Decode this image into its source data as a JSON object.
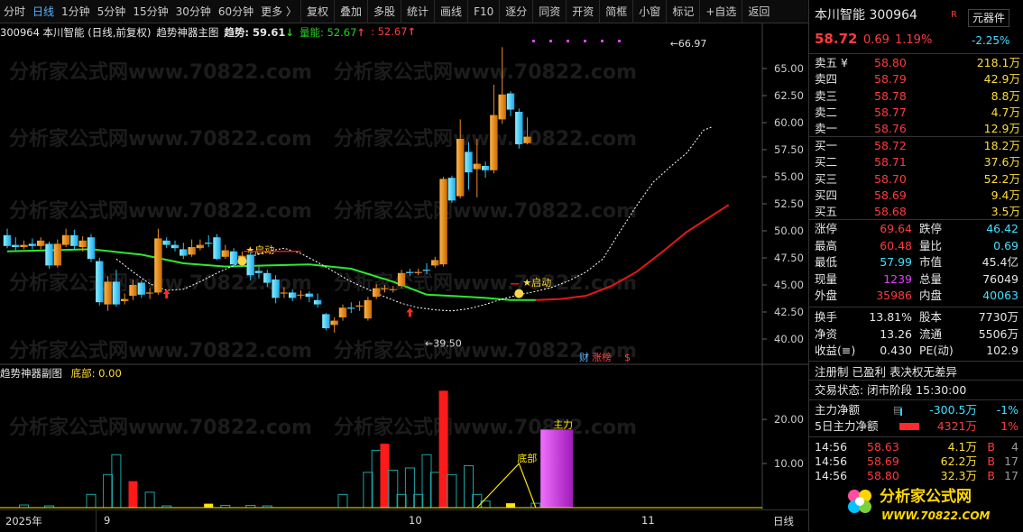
{
  "toolbar": {
    "items": [
      "分时",
      "日线",
      "1分钟",
      "5分钟",
      "15分钟",
      "30分钟",
      "60分钟",
      "更多 〉",
      "复权",
      "叠加",
      "多股",
      "统计",
      "画线",
      "F10",
      "逐分",
      "同资",
      "开资",
      "简框",
      "小窗",
      "标记",
      "+自选",
      "返回"
    ]
  },
  "header": {
    "code_name": "300964 本川智能 (日线,前复权)",
    "indicator": "趋势神器主图",
    "trend_label": "趋势: 59.61",
    "trend_arrow": "↓",
    "volume_label": "量能: 52.67",
    "volume_arrow": "↑",
    "extra_label": ": 52.67",
    "extra_arrow": "↑"
  },
  "sub_header": {
    "indicator": "趋势神器副图",
    "bottom_label": "底部: 0.00"
  },
  "annotations": {
    "high": "66.97",
    "low": "39.50",
    "start1": "★启动",
    "start2": "★启动",
    "fin": "财",
    "zt": "涨榜",
    "s": "$",
    "bottom_tag": "底部",
    "main_tag": "主力"
  },
  "y_axis_main": [
    "65.00",
    "62.50",
    "60.00",
    "57.50",
    "55.00",
    "52.50",
    "50.00",
    "47.50",
    "45.00",
    "42.50",
    "40.00"
  ],
  "y_axis_sub": [
    "20.00",
    "10.00"
  ],
  "x_axis": {
    "year": "2025年",
    "m9": "9",
    "m10": "10",
    "m11": "11",
    "period": "日线"
  },
  "side": {
    "title": "本川智能 300964",
    "flag": "R",
    "button": "元器件",
    "price": "58.72",
    "change": "0.69",
    "pct": "1.19%",
    "sector_pct": "-2.25%",
    "asks": [
      {
        "label": "卖五 ¥",
        "price": "58.80",
        "vol": "218.1万"
      },
      {
        "label": "卖四",
        "price": "58.79",
        "vol": "42.9万"
      },
      {
        "label": "卖三",
        "price": "58.78",
        "vol": "8.8万"
      },
      {
        "label": "卖二",
        "price": "58.77",
        "vol": "4.7万"
      },
      {
        "label": "卖一",
        "price": "58.76",
        "vol": "12.9万"
      }
    ],
    "bids": [
      {
        "label": "买一",
        "price": "58.72",
        "vol": "18.2万"
      },
      {
        "label": "买二",
        "price": "58.71",
        "vol": "37.6万"
      },
      {
        "label": "买三",
        "price": "58.70",
        "vol": "52.2万"
      },
      {
        "label": "买四",
        "price": "58.69",
        "vol": "9.4万"
      },
      {
        "label": "买五",
        "price": "58.68",
        "vol": "3.5万"
      }
    ],
    "stats": [
      {
        "l1": "涨停",
        "v1": "69.64",
        "c1": "red",
        "l2": "跌停",
        "v2": "46.42",
        "c2": "cyan"
      },
      {
        "l1": "最高",
        "v1": "60.48",
        "c1": "red",
        "l2": "量比",
        "v2": "0.69",
        "c2": "cyan"
      },
      {
        "l1": "最低",
        "v1": "57.99",
        "c1": "cyan",
        "l2": "市值",
        "v2": "45.4亿",
        "c2": "white"
      },
      {
        "l1": "现量",
        "v1": "1239",
        "c1": "mag",
        "l2": "总量",
        "v2": "76049",
        "c2": "white"
      },
      {
        "l1": "外盘",
        "v1": "35986",
        "c1": "red",
        "l2": "内盘",
        "v2": "40063",
        "c2": "cyan"
      }
    ],
    "stats2": [
      {
        "l1": "换手",
        "v1": "13.81%",
        "l2": "股本",
        "v2": "7730万"
      },
      {
        "l1": "净资",
        "v1": "13.26",
        "l2": "流通",
        "v2": "5506万"
      },
      {
        "l1": "收益(≡)",
        "v1": "0.430",
        "l2": "PE(动)",
        "v2": "102.9"
      }
    ],
    "tags": "注册制 已盈利 表决权无差异",
    "status": "交易状态: 闭市阶段 15:30:00",
    "flow": [
      {
        "label": "主力净额",
        "icon": "▤",
        "value": "-300.5万",
        "pct": "-1%"
      },
      {
        "label": "5日主力净额",
        "value": "4321万",
        "pct": "1%"
      }
    ],
    "ticks": [
      {
        "time": "14:56",
        "price": "58.63",
        "vol": "4.1万",
        "dir": "B",
        "n": "4"
      },
      {
        "time": "14:56",
        "price": "58.69",
        "vol": "62.2万",
        "dir": "B",
        "n": "17"
      },
      {
        "time": "14:56",
        "price": "58.80",
        "vol": "32.3万",
        "dir": "B",
        "n": "17"
      }
    ],
    "logo_text": "分析家公式网",
    "logo_url": "WWW.70822.COM"
  },
  "watermark": "分析家公式网www.70822.com",
  "chart_data": {
    "type": "candlestick",
    "ylim": [
      38.5,
      68
    ],
    "candles": [
      [
        49.6,
        48.6,
        50.2,
        48.4
      ],
      [
        48.7,
        48.5,
        49.4,
        48.2
      ],
      [
        48.5,
        48.7,
        49.1,
        48.3
      ],
      [
        48.8,
        48.6,
        49.3,
        48.3
      ],
      [
        48.6,
        49.1,
        49.4,
        48.3
      ],
      [
        48.8,
        46.8,
        49.0,
        46.5
      ],
      [
        46.8,
        48.8,
        49.2,
        46.6
      ],
      [
        48.7,
        49.6,
        50.2,
        48.5
      ],
      [
        49.6,
        48.6,
        50.1,
        48.3
      ],
      [
        48.5,
        49.1,
        49.5,
        48.1
      ],
      [
        49.4,
        47.4,
        49.7,
        47.1
      ],
      [
        47.2,
        43.4,
        47.5,
        43.1
      ],
      [
        43.2,
        45.3,
        45.8,
        42.6
      ],
      [
        45.3,
        43.2,
        46.4,
        43.0
      ],
      [
        43.5,
        43.7,
        44.2,
        43.2
      ],
      [
        44.0,
        45.0,
        45.5,
        43.6
      ],
      [
        45.2,
        44.1,
        45.4,
        43.8
      ],
      [
        44.2,
        44.3,
        44.7,
        43.7
      ],
      [
        44.3,
        49.3,
        50.2,
        44.1
      ],
      [
        49.1,
        48.7,
        49.4,
        48.4
      ],
      [
        48.7,
        48.4,
        49.1,
        48.1
      ],
      [
        48.3,
        47.7,
        48.9,
        47.4
      ],
      [
        47.8,
        48.5,
        49.2,
        47.6
      ],
      [
        48.4,
        48.7,
        49.2,
        48.2
      ],
      [
        48.9,
        48.8,
        49.6,
        48.5
      ],
      [
        49.4,
        47.4,
        49.7,
        47.3
      ],
      [
        47.6,
        48.2,
        48.7,
        47.4
      ],
      [
        48.1,
        46.9,
        48.4,
        46.6
      ],
      [
        47.2,
        47.7,
        48.1,
        46.7
      ],
      [
        47.8,
        45.9,
        48.1,
        45.4
      ],
      [
        46.3,
        46.1,
        46.7,
        45.6
      ],
      [
        46.1,
        45.2,
        46.4,
        44.8
      ],
      [
        45.5,
        43.8,
        45.9,
        43.3
      ],
      [
        44.2,
        44.3,
        44.8,
        43.8
      ],
      [
        44.3,
        43.8,
        44.6,
        43.5
      ],
      [
        44.1,
        44.1,
        44.5,
        43.7
      ],
      [
        44.2,
        43.9,
        44.4,
        43.4
      ],
      [
        43.6,
        43.2,
        44.2,
        42.9
      ],
      [
        42.3,
        41.0,
        42.4,
        40.8
      ],
      [
        41.3,
        41.7,
        42.0,
        40.6
      ],
      [
        42.0,
        42.9,
        43.2,
        41.7
      ],
      [
        42.9,
        42.8,
        43.4,
        42.4
      ],
      [
        43.0,
        43.1,
        43.5,
        42.6
      ],
      [
        41.9,
        43.6,
        43.9,
        41.7
      ],
      [
        43.9,
        44.7,
        45.1,
        43.7
      ],
      [
        44.6,
        44.7,
        45.0,
        44.3
      ],
      [
        44.6,
        44.6,
        44.9,
        44.3
      ],
      [
        44.9,
        46.1,
        46.4,
        44.7
      ],
      [
        46.2,
        46.1,
        46.5,
        45.8
      ],
      [
        46.1,
        46.2,
        46.5,
        45.9
      ],
      [
        46.4,
        46.3,
        47.0,
        46.0
      ],
      [
        46.8,
        47.3,
        47.6,
        46.6
      ],
      [
        46.9,
        54.8,
        55.0,
        46.7
      ],
      [
        54.9,
        52.8,
        55.1,
        52.6
      ],
      [
        53.2,
        58.5,
        60.3,
        53.0
      ],
      [
        57.3,
        55.4,
        58.2,
        53.8
      ],
      [
        55.7,
        56.2,
        58.5,
        53.1
      ],
      [
        56.0,
        55.6,
        56.4,
        54.9
      ],
      [
        55.6,
        60.7,
        63.5,
        55.3
      ],
      [
        60.3,
        62.6,
        66.97,
        59.9
      ],
      [
        62.7,
        61.2,
        62.9,
        60.6
      ],
      [
        61.0,
        58.0,
        61.3,
        57.6
      ],
      [
        58.1,
        58.7,
        60.48,
        57.99
      ]
    ],
    "ma_slow": [
      [
        0,
        48.1
      ],
      [
        10,
        48.3
      ],
      [
        16,
        47.8
      ],
      [
        21,
        47.0
      ],
      [
        26,
        46.7
      ],
      [
        31,
        46.8
      ],
      [
        36,
        46.9
      ],
      [
        41,
        46.5
      ],
      [
        46,
        45.3
      ],
      [
        50,
        44.1
      ],
      [
        55,
        43.9
      ],
      [
        57,
        43.8
      ],
      [
        60,
        43.6
      ],
      [
        63,
        43.6
      ],
      [
        66,
        43.7
      ],
      [
        69,
        44.0
      ],
      [
        72,
        44.9
      ],
      [
        75,
        46.2
      ],
      [
        78,
        48.0
      ],
      [
        81,
        49.9
      ],
      [
        84,
        51.4
      ],
      [
        86,
        52.4
      ]
    ],
    "ma_fast_dashed": [
      [
        13,
        47.4
      ],
      [
        15,
        46.2
      ],
      [
        17,
        45.1
      ],
      [
        19,
        44.5
      ],
      [
        21,
        44.6
      ],
      [
        23,
        45.3
      ],
      [
        25,
        46.1
      ],
      [
        27,
        46.8
      ],
      [
        29,
        47.6
      ],
      [
        31,
        48.1
      ],
      [
        33,
        48.4
      ],
      [
        35,
        47.9
      ],
      [
        37,
        47.1
      ],
      [
        39,
        46.2
      ],
      [
        41,
        45.3
      ],
      [
        43,
        44.6
      ],
      [
        45,
        43.9
      ],
      [
        47,
        43.3
      ],
      [
        49,
        42.9
      ],
      [
        51,
        42.7
      ],
      [
        53,
        42.6
      ],
      [
        55,
        42.8
      ],
      [
        57,
        43.2
      ],
      [
        59,
        43.7
      ],
      [
        61,
        44.1
      ],
      [
        63,
        44.4
      ],
      [
        65,
        44.8
      ],
      [
        67,
        45.4
      ],
      [
        69,
        46.2
      ],
      [
        71,
        47.4
      ],
      [
        73,
        49.9
      ],
      [
        75,
        52.3
      ],
      [
        77,
        54.5
      ],
      [
        79,
        55.9
      ],
      [
        81,
        57.2
      ],
      [
        83,
        59.3
      ],
      [
        84,
        59.6
      ]
    ],
    "volume_bars": [
      {
        "i": 2,
        "v": 0.6,
        "c": "teal"
      },
      {
        "i": 5,
        "v": 0.4,
        "c": "teal"
      },
      {
        "i": 10,
        "v": 3.0,
        "c": "teal"
      },
      {
        "i": 12,
        "v": 7.5,
        "c": "teal"
      },
      {
        "i": 13,
        "v": 12.0,
        "c": "teal"
      },
      {
        "i": 15,
        "v": 6.0,
        "c": "red"
      },
      {
        "i": 17,
        "v": 3.5,
        "c": "teal"
      },
      {
        "i": 19,
        "v": 0.4,
        "c": "teal"
      },
      {
        "i": 24,
        "v": 0.9,
        "c": "yellow"
      },
      {
        "i": 26,
        "v": 0.5,
        "c": "teal"
      },
      {
        "i": 29,
        "v": 0.5,
        "c": "teal"
      },
      {
        "i": 31,
        "v": 0.4,
        "c": "teal"
      },
      {
        "i": 40,
        "v": 3.0,
        "c": "teal"
      },
      {
        "i": 43,
        "v": 8.0,
        "c": "teal"
      },
      {
        "i": 44,
        "v": 13.0,
        "c": "teal"
      },
      {
        "i": 45,
        "v": 14.5,
        "c": "red"
      },
      {
        "i": 46,
        "v": 8.5,
        "c": "teal"
      },
      {
        "i": 47,
        "v": 3.0,
        "c": "teal"
      },
      {
        "i": 48,
        "v": 9.0,
        "c": "teal"
      },
      {
        "i": 49,
        "v": 3.0,
        "c": "teal"
      },
      {
        "i": 50,
        "v": 12.0,
        "c": "teal"
      },
      {
        "i": 51,
        "v": 8.0,
        "c": "teal"
      },
      {
        "i": 52,
        "v": 26.5,
        "c": "red"
      },
      {
        "i": 53,
        "v": 7.5,
        "c": "teal"
      },
      {
        "i": 55,
        "v": 9.5,
        "c": "teal"
      },
      {
        "i": 56,
        "v": 3.0,
        "c": "teal"
      },
      {
        "i": 57,
        "v": 1.5,
        "c": "teal"
      },
      {
        "i": 60,
        "v": 1.0,
        "c": "yellow"
      },
      {
        "i": 63,
        "v": 1.0,
        "c": "teal"
      }
    ],
    "bottom_curve": [
      [
        56,
        0
      ],
      [
        61,
        10
      ],
      [
        63,
        0
      ]
    ],
    "main_block": {
      "i0": 64,
      "i1": 67,
      "v": 17.7
    },
    "sub_ylim": [
      0,
      28
    ]
  }
}
